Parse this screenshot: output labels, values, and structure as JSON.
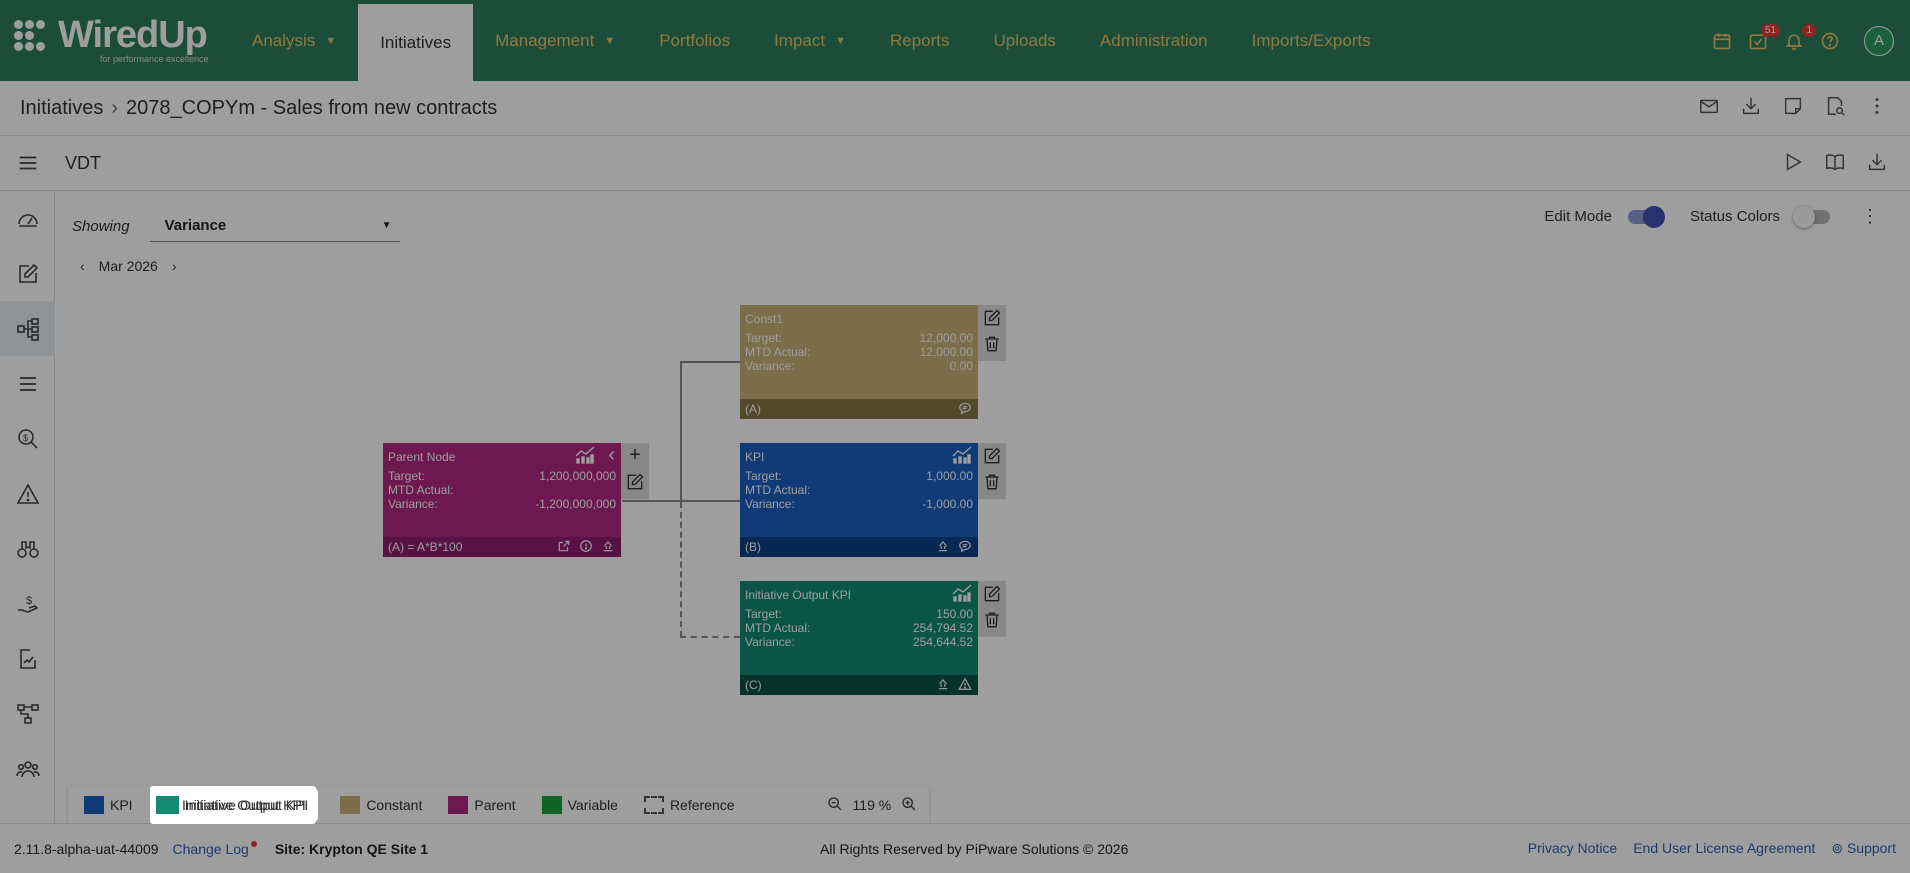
{
  "brand": {
    "name": "WiredUp",
    "tagline": "for performance excellence"
  },
  "nav": {
    "items": [
      {
        "label": "Analysis",
        "caret": true
      },
      {
        "label": "Initiatives",
        "active": true
      },
      {
        "label": "Management",
        "caret": true
      },
      {
        "label": "Portfolios"
      },
      {
        "label": "Impact",
        "caret": true
      },
      {
        "label": "Reports"
      },
      {
        "label": "Uploads"
      },
      {
        "label": "Administration"
      },
      {
        "label": "Imports/Exports"
      }
    ],
    "tasks_badge": "51",
    "notifications_badge": "1",
    "avatar_initial": "A"
  },
  "breadcrumb": {
    "root": "Initiatives",
    "current": "2078_COPYm - Sales from new contracts"
  },
  "toolbar": {
    "title": "VDT"
  },
  "controls": {
    "showing_label": "Showing",
    "showing_value": "Variance",
    "edit_mode_label": "Edit Mode",
    "edit_mode_on": true,
    "status_colors_label": "Status Colors",
    "status_colors_on": false,
    "period": "Mar 2026"
  },
  "nodes": {
    "parent": {
      "title": "Parent Node",
      "target_label": "Target:",
      "target": "1,200,000,000",
      "actual_label": "MTD Actual:",
      "actual": "",
      "variance_label": "Variance:",
      "variance": "-1,200,000,000",
      "formula": "(A) = A*B*100",
      "color": "#8e1f6e"
    },
    "const1": {
      "title": "Const1",
      "target_label": "Target:",
      "target": "12,000.00",
      "actual_label": "MTD Actual:",
      "actual": "12,000.00",
      "variance_label": "Variance:",
      "variance": "0.00",
      "tag": "(A)",
      "color": "#8a7648"
    },
    "kpi": {
      "title": "KPI",
      "target_label": "Target:",
      "target": "1,000.00",
      "actual_label": "MTD Actual:",
      "actual": "",
      "variance_label": "Variance:",
      "variance": "-1,000.00",
      "tag": "(B)",
      "color": "#0f3f86"
    },
    "output": {
      "title": "Initiative Output KPI",
      "target_label": "Target:",
      "target": "150.00",
      "actual_label": "MTD Actual:",
      "actual": "254,794.52",
      "variance_label": "Variance:",
      "variance": "254,644.52",
      "tag": "(C)",
      "color": "#0c5140"
    }
  },
  "legend": {
    "items": [
      {
        "label": "KPI",
        "color": "#1a5fbf"
      },
      {
        "label": "Initiative Output KPI",
        "color": "#138a72"
      },
      {
        "label": "Constant",
        "color": "#c9b27a"
      },
      {
        "label": "Parent",
        "color": "#b0287f"
      },
      {
        "label": "Variable",
        "color": "#1e9e3e"
      },
      {
        "label": "Reference",
        "color": "dashed"
      }
    ],
    "zoom": "119 %"
  },
  "footer": {
    "version": "2.11.8-alpha-uat-44009",
    "change_log": "Change Log",
    "site": "Site: Krypton QE Site 1",
    "rights": "All Rights Reserved by PiPware Solutions © 2026",
    "privacy": "Privacy Notice",
    "eula": "End User License Agreement",
    "support": "Support"
  }
}
